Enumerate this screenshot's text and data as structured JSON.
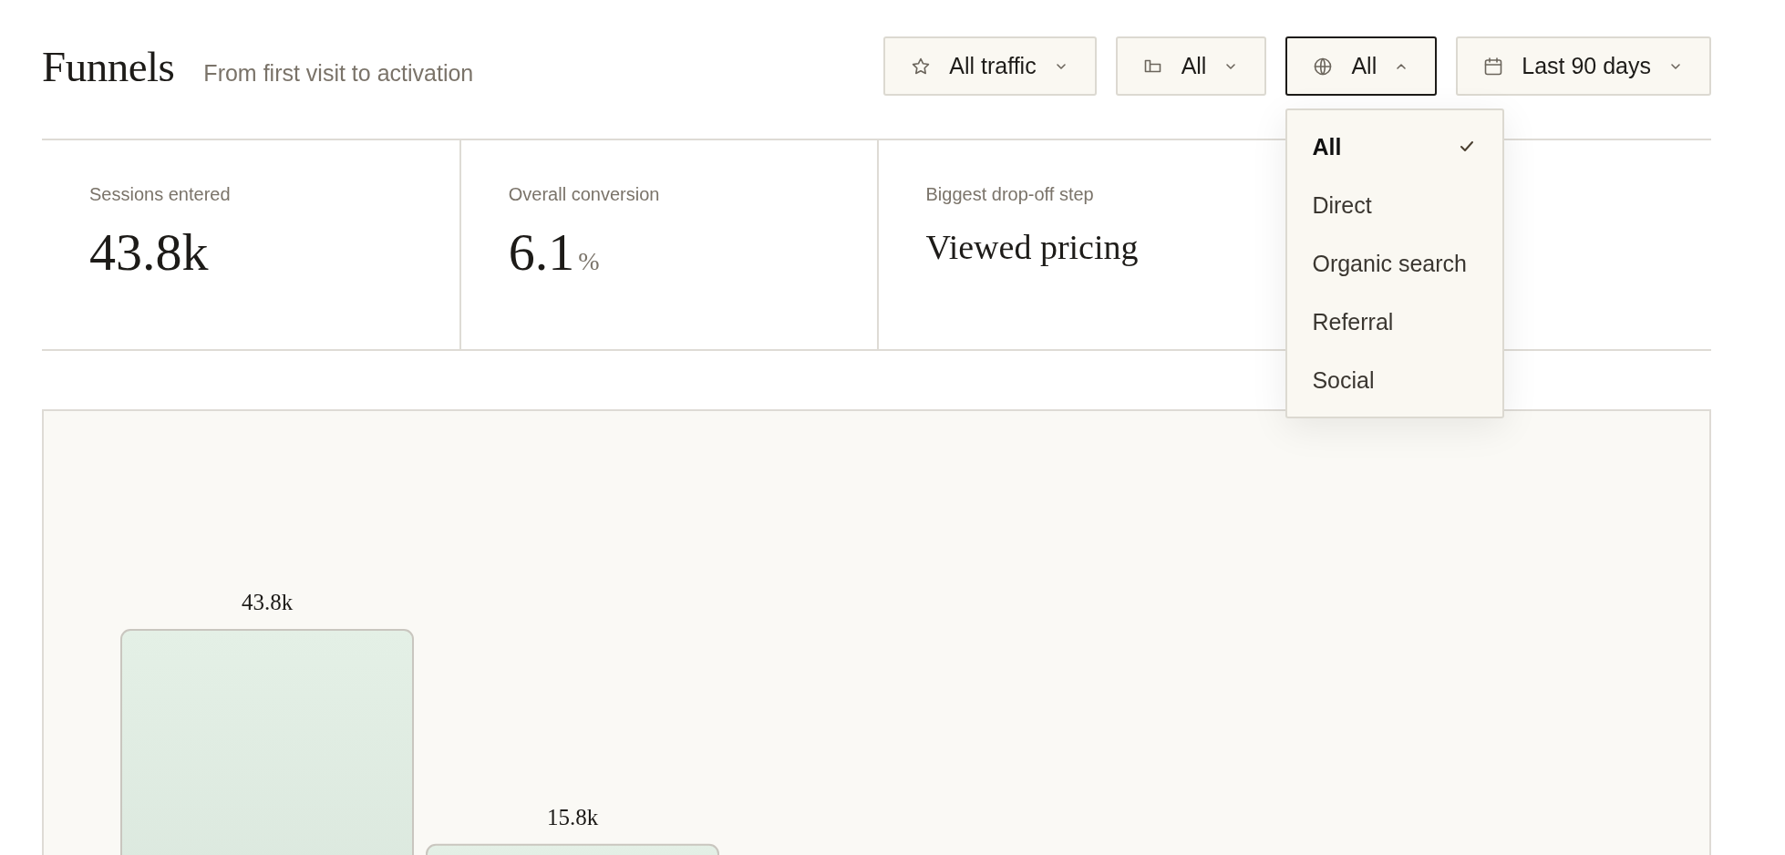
{
  "header": {
    "title": "Funnels",
    "subtitle": "From first visit to activation"
  },
  "filters": [
    {
      "label": "All traffic",
      "expanded": false
    },
    {
      "label": "All",
      "expanded": false
    },
    {
      "label": "All",
      "expanded": true
    },
    {
      "label": "Last 90 days",
      "expanded": false
    }
  ],
  "menu": {
    "items": [
      {
        "label": "All",
        "selected": true
      },
      {
        "label": "Direct",
        "selected": false
      },
      {
        "label": "Organic search",
        "selected": false
      },
      {
        "label": "Referral",
        "selected": false
      },
      {
        "label": "Social",
        "selected": false
      }
    ]
  },
  "kpis": [
    {
      "kind": "number",
      "label": "Sessions entered",
      "value": "43.8k"
    },
    {
      "kind": "number",
      "label": "Overall conversion",
      "value": "6.1",
      "unit": "%"
    },
    {
      "kind": "text",
      "label": "Biggest drop-off step",
      "value": "Viewed pricing"
    }
  ],
  "funnel_steps": [
    {
      "value": "43.8k",
      "level": 1
    },
    {
      "value": "15.8k",
      "level": 0.361
    }
  ]
}
